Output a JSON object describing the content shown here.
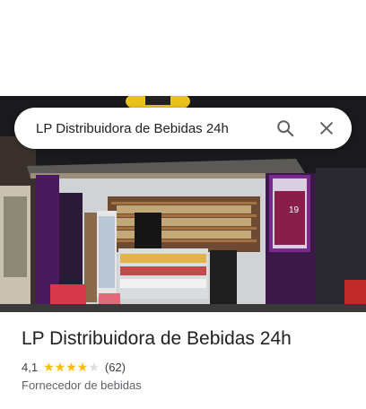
{
  "search": {
    "query": "LP Distribuidora de Bebidas 24h"
  },
  "place": {
    "name": "LP Distribuidora de Bebidas 24h",
    "rating": "4,1",
    "rating_value": 4.1,
    "reviews": "(62)",
    "category": "Fornecedor de bebidas"
  },
  "photo": {
    "sign_text": "19"
  },
  "icons": {
    "search": "search-icon",
    "close": "close-icon",
    "star": "star-icon"
  },
  "colors": {
    "star": "#fbbc04",
    "star_empty": "#dadce0",
    "storefront_purple": "#6a1f8a"
  }
}
